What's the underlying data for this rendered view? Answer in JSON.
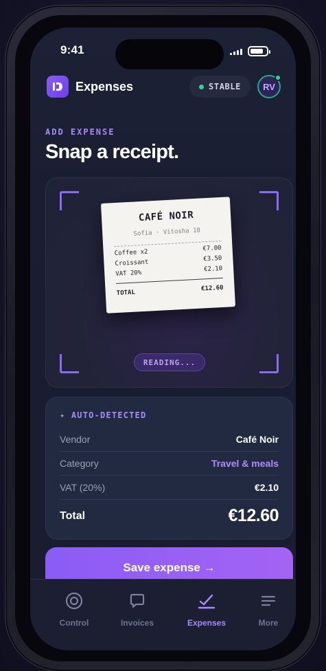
{
  "status_bar": {
    "time": "9:41"
  },
  "header": {
    "app_title": "Expenses",
    "status_label": "STABLE",
    "avatar_initials": "RV"
  },
  "page": {
    "eyebrow": "ADD EXPENSE",
    "headline": "Snap a receipt."
  },
  "receipt": {
    "name": "CAFÉ NOIR",
    "address": "Sofia · Vitosha 18",
    "items": [
      {
        "label": "Coffee x2",
        "price": "€7.00"
      },
      {
        "label": "Croissant",
        "price": "€3.50"
      },
      {
        "label": "VAT 20%",
        "price": "€2.10"
      }
    ],
    "total_label": "TOTAL",
    "total_value": "€12.60"
  },
  "scanner": {
    "status": "READING..."
  },
  "detected": {
    "title": "✦ AUTO-DETECTED",
    "rows": [
      {
        "key": "Vendor",
        "value": "Café Noir"
      },
      {
        "key": "Category",
        "value": "Travel & meals"
      },
      {
        "key": "VAT (20%)",
        "value": "€2.10"
      }
    ],
    "total_label": "Total",
    "total_value": "€12.60"
  },
  "actions": {
    "save_label": "Save expense →"
  },
  "tabs": [
    {
      "label": "Control",
      "icon": "target-icon",
      "active": false
    },
    {
      "label": "Invoices",
      "icon": "chat-bubble-icon",
      "active": false
    },
    {
      "label": "Expenses",
      "icon": "check-icon",
      "active": true
    },
    {
      "label": "More",
      "icon": "menu-icon",
      "active": false
    }
  ],
  "colors": {
    "accent": "#8b5cf6",
    "accent_text": "#a78bfa",
    "success": "#34d399",
    "background": "#1a1d30"
  }
}
